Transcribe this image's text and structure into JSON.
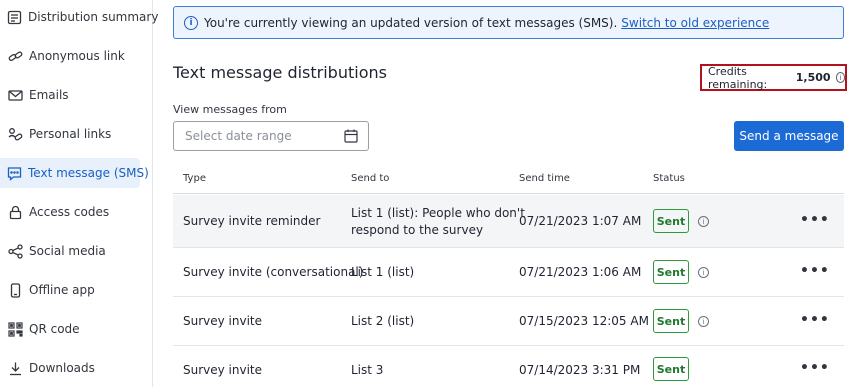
{
  "sidebar": {
    "items": [
      {
        "label": "Distribution summary",
        "icon": "summary-icon"
      },
      {
        "label": "Anonymous link",
        "icon": "link-icon"
      },
      {
        "label": "Emails",
        "icon": "envelope-icon"
      },
      {
        "label": "Personal links",
        "icon": "personal-link-icon"
      },
      {
        "label": "Text message (SMS)",
        "icon": "sms-icon"
      },
      {
        "label": "Access codes",
        "icon": "lock-icon"
      },
      {
        "label": "Social media",
        "icon": "share-icon"
      },
      {
        "label": "Offline app",
        "icon": "phone-icon"
      },
      {
        "label": "QR code",
        "icon": "qr-icon"
      },
      {
        "label": "Downloads",
        "icon": "download-icon"
      }
    ],
    "active_index": 4
  },
  "banner": {
    "text": "You're currently viewing an updated version of text messages (SMS).",
    "link": "Switch to old experience"
  },
  "page": {
    "title": "Text message distributions",
    "credits_label": "Credits remaining:",
    "credits_value": "1,500",
    "view_label": "View messages from",
    "date_placeholder": "Select date range",
    "send_button": "Send a message"
  },
  "table": {
    "headers": {
      "type": "Type",
      "send_to": "Send to",
      "send_time": "Send time",
      "status": "Status"
    },
    "rows": [
      {
        "type": "Survey invite reminder",
        "send_to_1": "List 1 (list): People who don't",
        "send_to_2": "respond to the survey",
        "send_time": "07/21/2023 1:07 AM",
        "status": "Sent"
      },
      {
        "type": "Survey invite (conversational)",
        "send_to_1": "List 1 (list)",
        "send_to_2": "",
        "send_time": "07/21/2023 1:06 AM",
        "status": "Sent"
      },
      {
        "type": "Survey invite",
        "send_to_1": "List 2 (list)",
        "send_to_2": "",
        "send_time": "07/15/2023 12:05 AM",
        "status": "Sent"
      },
      {
        "type": "Survey invite",
        "send_to_1": "List 3",
        "send_to_2": "",
        "send_time": "07/14/2023 3:31 PM",
        "status": "Sent"
      }
    ]
  },
  "colors": {
    "accent": "#1b6ad6",
    "success": "#2e9a3a",
    "highlight": "#b3121c"
  }
}
